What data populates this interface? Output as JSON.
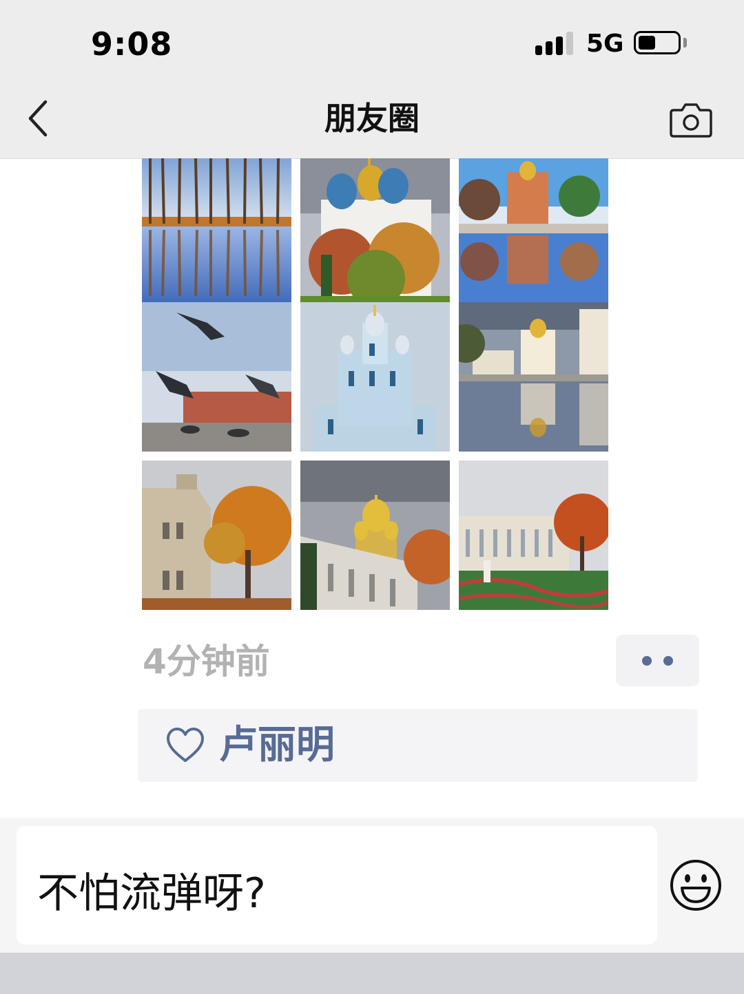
{
  "status_bar": {
    "time": "9:08",
    "network": "5G",
    "battery_level": 0.45
  },
  "nav": {
    "title": "朋友圈",
    "back_icon": "chevron-left-icon",
    "camera_icon": "camera-icon"
  },
  "post": {
    "timestamp": "4分钟前",
    "more_icon": "two-dots-icon",
    "likes": {
      "icon": "heart-outline-icon",
      "names": "卢丽明"
    }
  },
  "comment_bar": {
    "draft": "不怕流弹呀?",
    "emoji_icon": "smiley-icon"
  },
  "colors": {
    "link_blue": "#576b95",
    "timestamp_gray": "#b2b2b2",
    "header_bg": "#ededed"
  }
}
